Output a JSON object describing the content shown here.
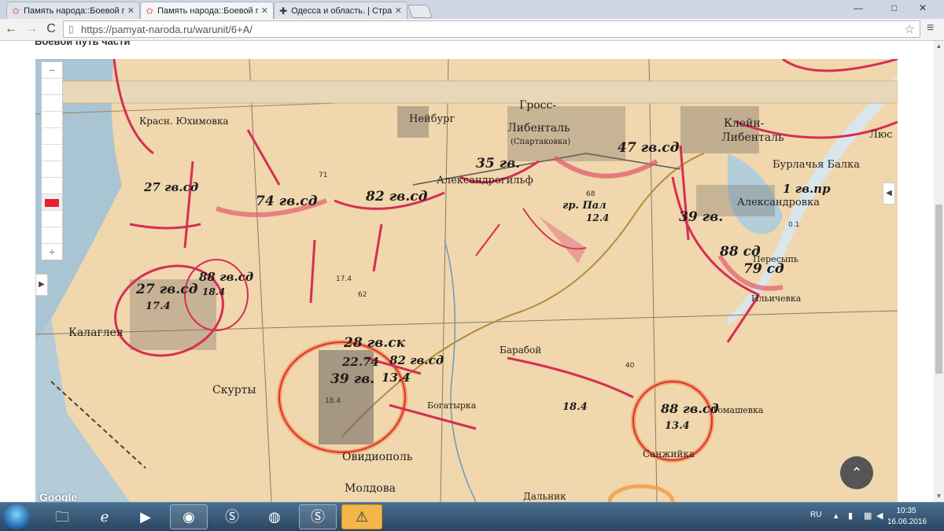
{
  "tabs": [
    {
      "label": "Память народа::Боевой п",
      "icon": "red-star-icon",
      "active": false
    },
    {
      "label": "Память народа::Боевой п",
      "icon": "red-star-icon",
      "active": true
    },
    {
      "label": "Одесса и область. | Стра",
      "icon": "cross-icon",
      "active": false
    }
  ],
  "window_controls": {
    "minimize": "—",
    "maximize": "□",
    "close": "✕"
  },
  "toolbar": {
    "back": "←",
    "forward": "→",
    "reload": "C",
    "url": "https://pamyat-naroda.ru/warunit/6+A/",
    "menu": "≡"
  },
  "page": {
    "section_title": "Боевой путь части",
    "google_label": "Google",
    "to_top": "⌃"
  },
  "zoom": {
    "minus": "−",
    "plus": "+"
  },
  "map_labels": {
    "places": [
      "Красн. Юхимовка",
      "Нейбург",
      "Гросс-",
      "Либенталь",
      "(Спартаковка)",
      "Клейн-",
      "Либенталь",
      "Бурлачья Балка",
      "Люс",
      "Александрогильф",
      "Александровка",
      "Пересыпь",
      "Ильичевка",
      "Калаглея",
      "Скурты",
      "Барабой",
      "Богатырка",
      "Томашевка",
      "Санжийка",
      "Овидиополь",
      "Молдова",
      "Дальник"
    ],
    "units": [
      "27 гв.сд",
      "74 гв.сд",
      "82 гв.сд",
      "35 гв.",
      "47 гв.сд",
      "1 гв.пр",
      "гр. Пал",
      "12.4",
      "39 гв.",
      "88 сд",
      "79 сд",
      "88 гв.сд",
      "18.4",
      "27 гв.сд",
      "17.4",
      "28 гв.ск",
      "22.74",
      "82 гв.сд",
      "39 гв.",
      "13.4",
      "18.4",
      "88 гв.сд",
      "13.4"
    ],
    "elev": [
      "71",
      "62",
      "68",
      "17.4",
      "40",
      "18.4",
      "0.1"
    ]
  },
  "taskbar": {
    "apps": [
      "file-explorer-icon",
      "internet-explorer-icon",
      "media-player-icon",
      "chrome-icon",
      "skype-icon",
      "firefox-icon",
      "skype-icon",
      "warning-icon"
    ],
    "lang": "RU",
    "time": "10:35",
    "date": "16.06.2016"
  }
}
